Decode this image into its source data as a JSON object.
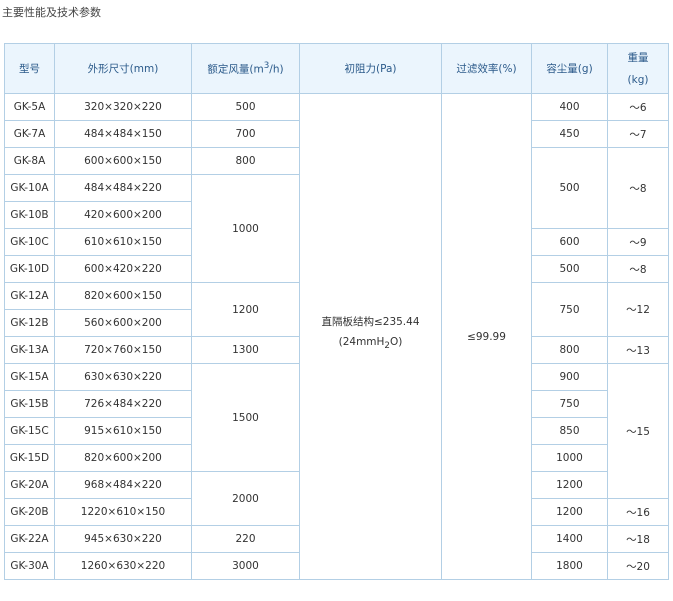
{
  "page": {
    "title": "主要性能及技术参数"
  },
  "table": {
    "headers": {
      "model": "型号",
      "size": "外形尺寸(mm)",
      "airflow_prefix": "额定风量(m",
      "airflow_sup": "3",
      "airflow_suffix": "/h)",
      "resistance": "初阻力(Pa)",
      "efficiency": "过滤效率(%)",
      "dust": "容尘量(g)",
      "weight_line1": "重量",
      "weight_line2": "(kg)"
    },
    "resistance_value_line1": "直隔板结构≤235.44",
    "resistance_value_line2_prefix": "(24mmH",
    "resistance_value_line2_sub": "2",
    "resistance_value_line2_suffix": "O)",
    "efficiency_value": "≤99.99",
    "models": [
      "GK-5A",
      "GK-7A",
      "GK-8A",
      "GK-10A",
      "GK-10B",
      "GK-10C",
      "GK-10D",
      "GK-12A",
      "GK-12B",
      "GK-13A",
      "GK-15A",
      "GK-15B",
      "GK-15C",
      "GK-15D",
      "GK-20A",
      "GK-20B",
      "GK-22A",
      "GK-30A"
    ],
    "sizes": [
      "320×320×220",
      "484×484×150",
      "600×600×150",
      "484×484×220",
      "420×600×200",
      "610×610×150",
      "600×420×220",
      "820×600×150",
      "560×600×200",
      "720×760×150",
      "630×630×220",
      "726×484×220",
      "915×610×150",
      "820×600×200",
      "968×484×220",
      "1220×610×150",
      "945×630×220",
      "1260×630×220"
    ],
    "airflow": [
      "500",
      "700",
      "800",
      "1000",
      "1200",
      "1300",
      "1500",
      "2000",
      "220",
      "3000"
    ],
    "dust": [
      "400",
      "450",
      "500",
      "600",
      "500",
      "750",
      "800",
      "900",
      "750",
      "850",
      "1000",
      "1200",
      "1200",
      "1400",
      "1800"
    ],
    "weight": [
      "～6",
      "～7",
      "～8",
      "～9",
      "～8",
      "～12",
      "～13",
      "～15",
      "～16",
      "～18",
      "～20"
    ]
  }
}
